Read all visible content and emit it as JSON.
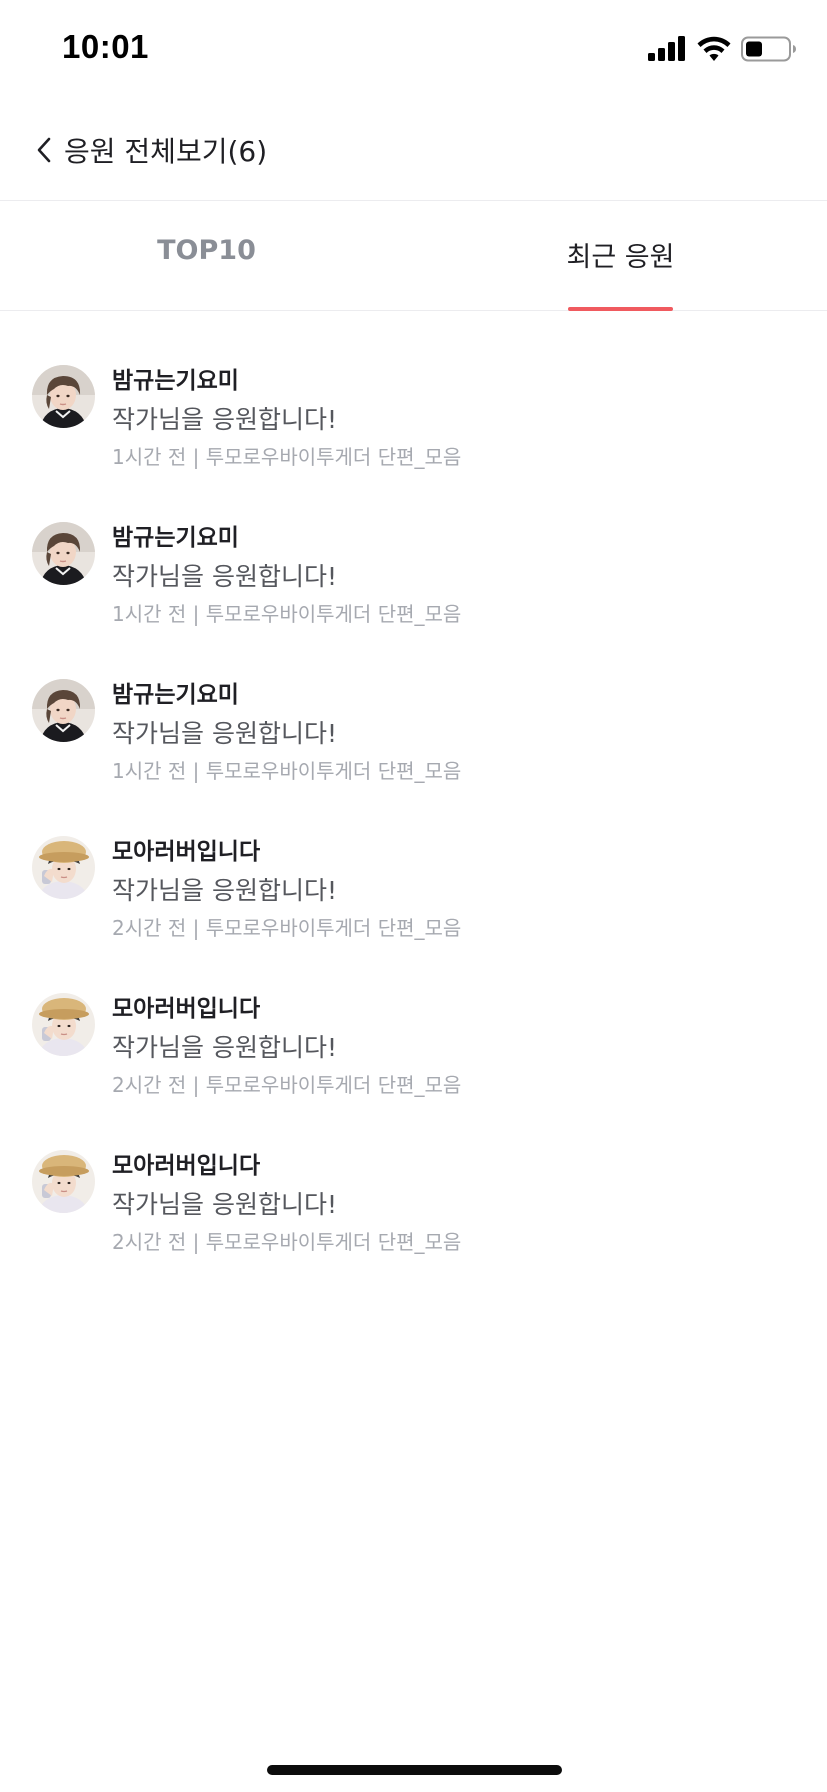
{
  "status_bar": {
    "time": "10:01",
    "icons": [
      "signal-icon",
      "wifi-icon",
      "battery-icon"
    ]
  },
  "header": {
    "back_icon": "chevron-left-icon",
    "title": "응원 전체보기(6)"
  },
  "tabs": [
    {
      "label": "TOP10",
      "selected": false
    },
    {
      "label": "최근 응원",
      "selected": true
    }
  ],
  "colors": {
    "accent": "#f05a5f",
    "text_primary": "#1f1f24",
    "text_secondary": "#55575d",
    "text_meta": "#a6a9b0",
    "tab_inactive": "#8a8e96"
  },
  "cheers": [
    {
      "name": "밤규는기요미",
      "message": "작가님을 응원합니다!",
      "meta": "1시간 전 | 투모로우바이투게더 단편_모음",
      "avatar": "user-avatar-a"
    },
    {
      "name": "밤규는기요미",
      "message": "작가님을 응원합니다!",
      "meta": "1시간 전 | 투모로우바이투게더 단편_모음",
      "avatar": "user-avatar-a"
    },
    {
      "name": "밤규는기요미",
      "message": "작가님을 응원합니다!",
      "meta": "1시간 전 | 투모로우바이투게더 단편_모음",
      "avatar": "user-avatar-a"
    },
    {
      "name": "모아러버입니다",
      "message": "작가님을 응원합니다!",
      "meta": "2시간 전 | 투모로우바이투게더 단편_모음",
      "avatar": "user-avatar-b"
    },
    {
      "name": "모아러버입니다",
      "message": "작가님을 응원합니다!",
      "meta": "2시간 전 | 투모로우바이투게더 단편_모음",
      "avatar": "user-avatar-b"
    },
    {
      "name": "모아러버입니다",
      "message": "작가님을 응원합니다!",
      "meta": "2시간 전 | 투모로우바이투게더 단편_모음",
      "avatar": "user-avatar-b"
    }
  ]
}
